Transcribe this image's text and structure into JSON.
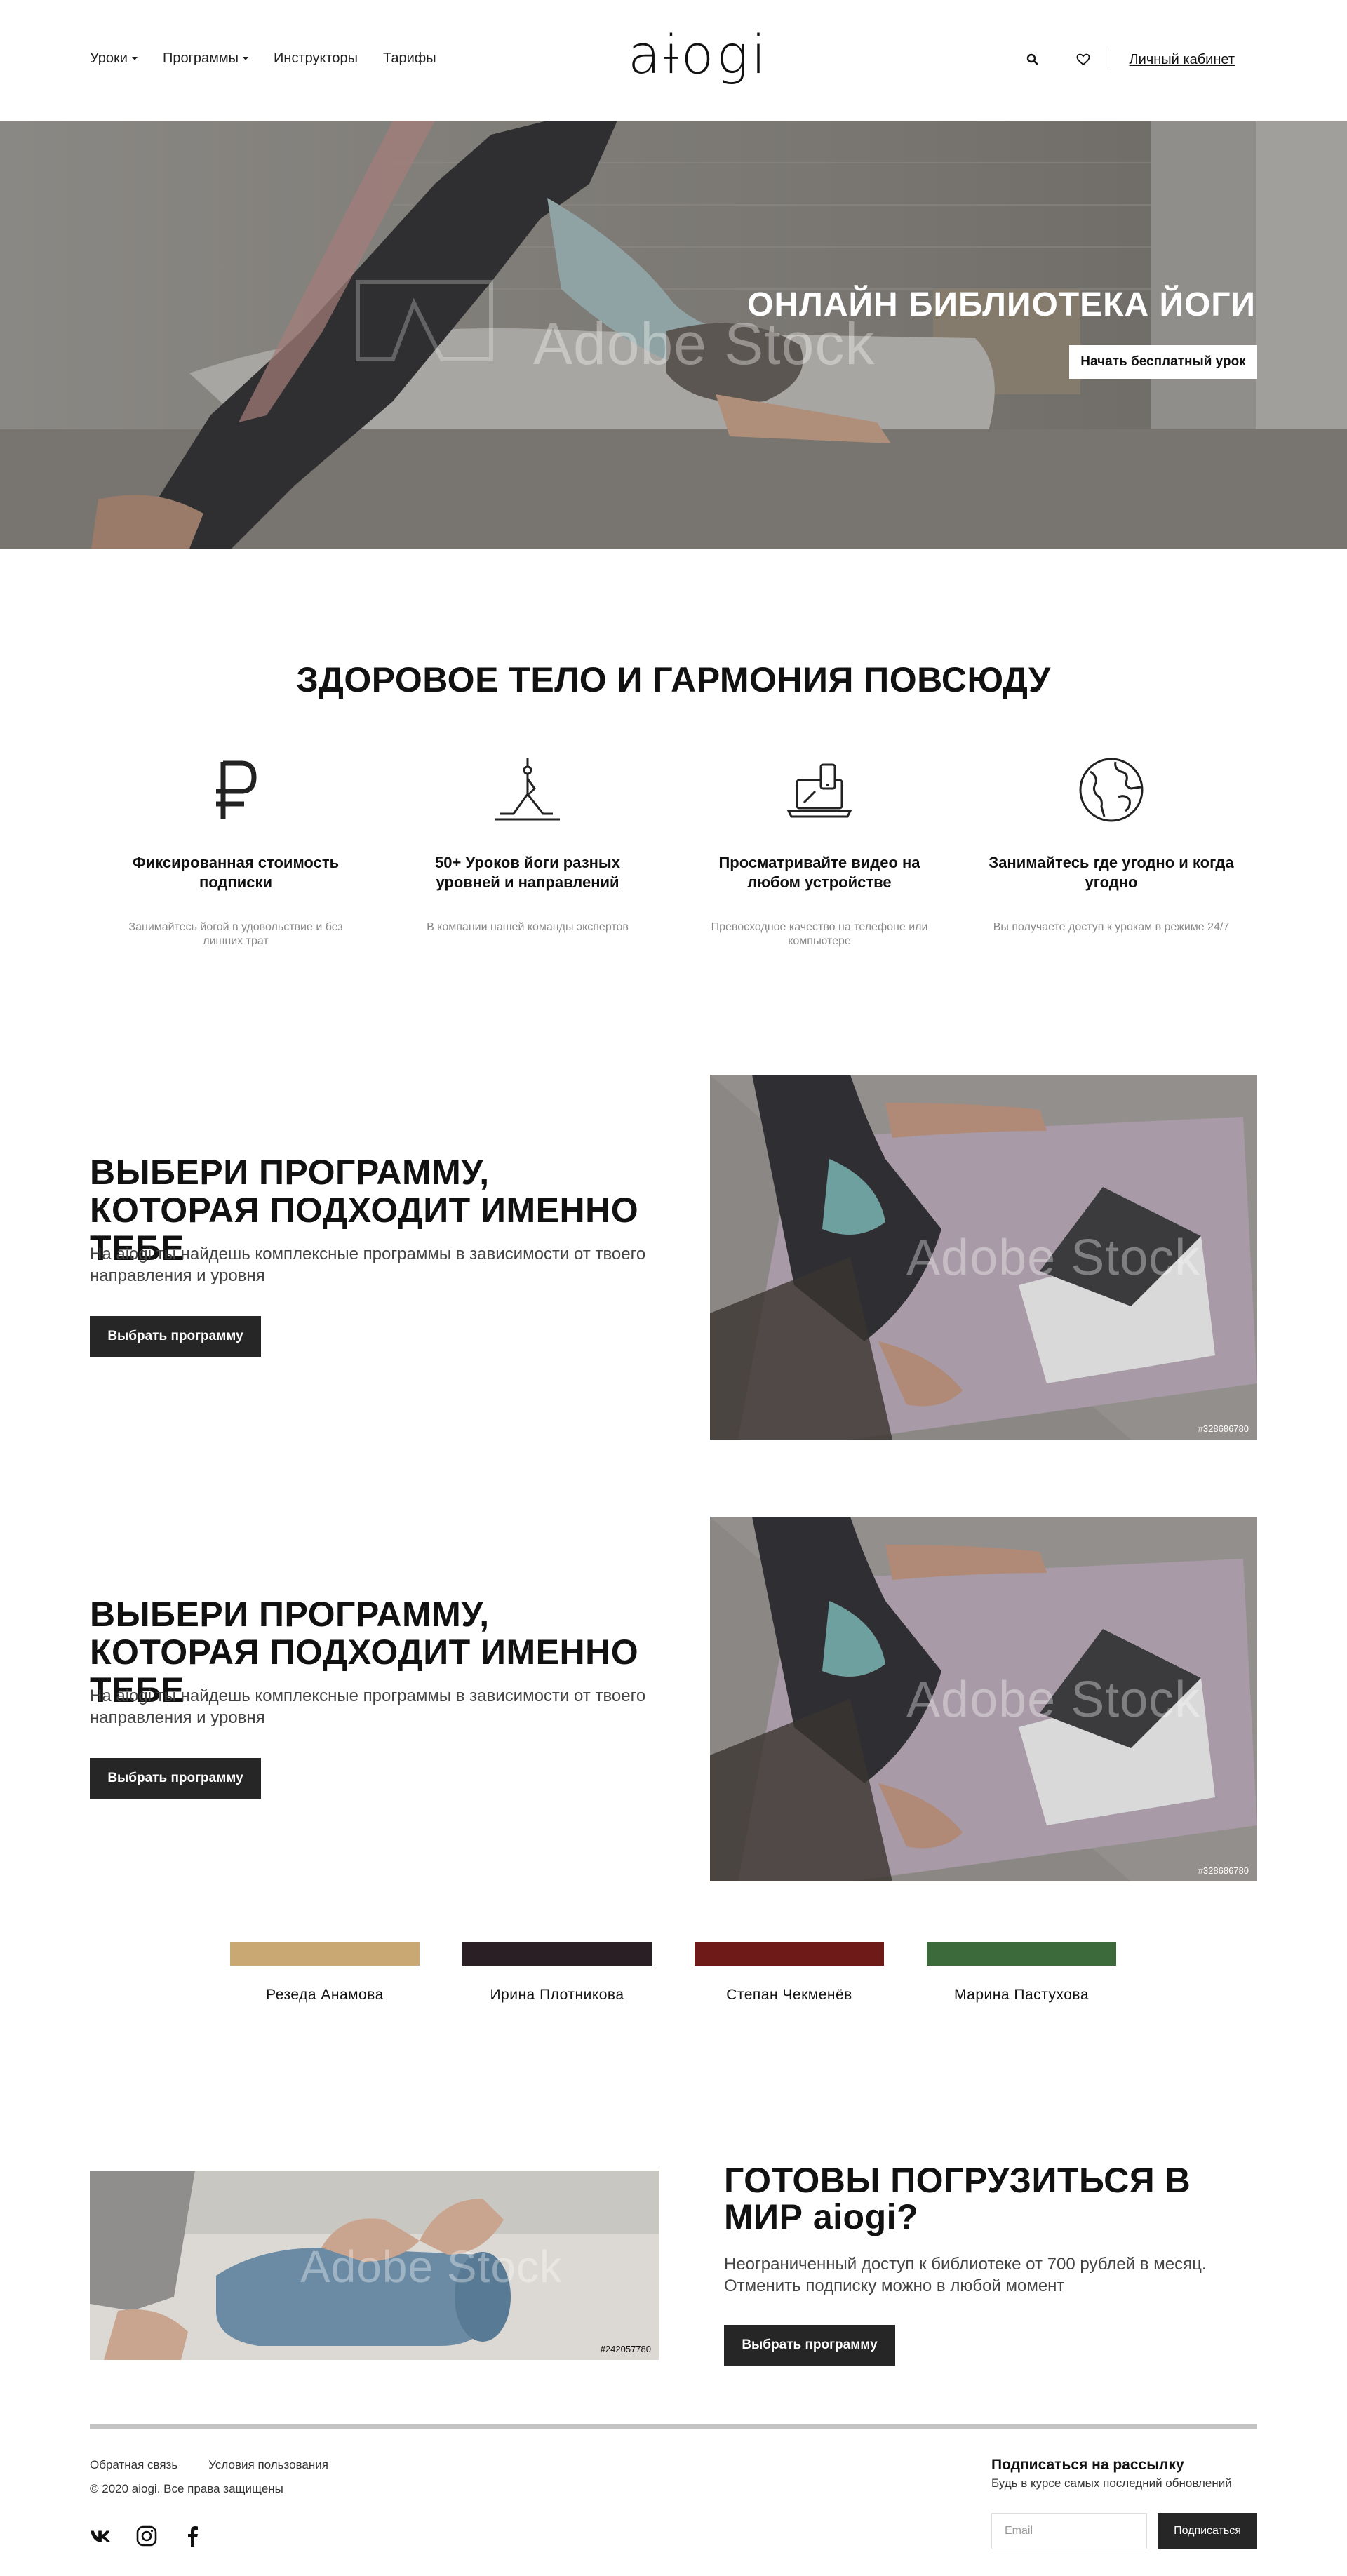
{
  "header": {
    "logo": "aɨogi",
    "nav": [
      {
        "label": "Уроки",
        "dropdown": true
      },
      {
        "label": "Программы",
        "dropdown": true
      },
      {
        "label": "Инструкторы",
        "dropdown": false
      },
      {
        "label": "Тарифы",
        "dropdown": false
      }
    ],
    "search_icon": "search-icon",
    "favorites_icon": "heart-icon",
    "cabinet_label": "Личный кабинет"
  },
  "hero": {
    "title": "ОНЛАЙН БИБЛИОТЕКА ЙОГИ",
    "button_label": "Начать бесплатный урок",
    "watermark": "Adobe Stock"
  },
  "features": {
    "title": "ЗДОРОВОЕ ТЕЛО И ГАРМОНИЯ ПОВСЮДУ",
    "items": [
      {
        "icon": "ruble-icon",
        "title": "Фиксированная стоимость подписки",
        "text": "Занимайтесь йогой в удовольствие и без лишних трат"
      },
      {
        "icon": "yoga-pose-icon",
        "title": "50+ Уроков йоги разных уровней и направлений",
        "text": "В компании нашей команды экспертов"
      },
      {
        "icon": "devices-icon",
        "title": "Просматривайте видео на любом устройстве",
        "text": "Превосходное качество на телефоне или компьютере"
      },
      {
        "icon": "globe-icon",
        "title": "Занимайтесь где угодно и когда угодно",
        "text": "Вы получаете доступ к урокам в режиме 24/7"
      }
    ]
  },
  "programs": [
    {
      "title": "ВЫБЕРИ ПРОГРАММУ, КОТОРАЯ ПОДХОДИТ ИМЕННО ТЕБЕ",
      "description": "На aiogi ты найдешь комплексные программы в зависимости от твоего направления и уровня",
      "button_label": "Выбрать программу",
      "stock_id": "#328686780",
      "watermark": "Adobe Stock"
    },
    {
      "title": "ВЫБЕРИ ПРОГРАММУ, КОТОРАЯ ПОДХОДИТ ИМЕННО ТЕБЕ",
      "description": "На aiogi ты найдешь комплексные программы в зависимости от твоего направления и уровня",
      "button_label": "Выбрать программу",
      "stock_id": "#328686780",
      "watermark": "Adobe Stock"
    }
  ],
  "instructors": [
    {
      "name": "Резеда Анамова",
      "color": "#c9a874"
    },
    {
      "name": "Ирина Плотникова",
      "color": "#2a1f25"
    },
    {
      "name": "Степан Чекменёв",
      "color": "#6e1a18"
    },
    {
      "name": "Марина Пастухова",
      "color": "#3d6a3a"
    }
  ],
  "cta": {
    "title": "ГОТОВЫ ПОГРУЗИТЬСЯ В МИР aiogi?",
    "description": "Неограниченный доступ к библиотеке от 700 рублей в месяц. Отменить подписку можно в любой момент",
    "button_label": "Выбрать программу",
    "stock_id": "#242057780",
    "watermark": "Adobe Stock"
  },
  "footer": {
    "links": [
      "Обратная связь",
      "Условия пользования"
    ],
    "copyright": "© 2020 aiogi. Все права защищены",
    "socials": [
      "vk-icon",
      "instagram-icon",
      "facebook-icon"
    ],
    "newsletter": {
      "title": "Подписаться на рассылку",
      "subtitle": "Будь в курсе самых последний обновлений",
      "email_placeholder": "Email",
      "button_label": "Подписаться"
    }
  }
}
